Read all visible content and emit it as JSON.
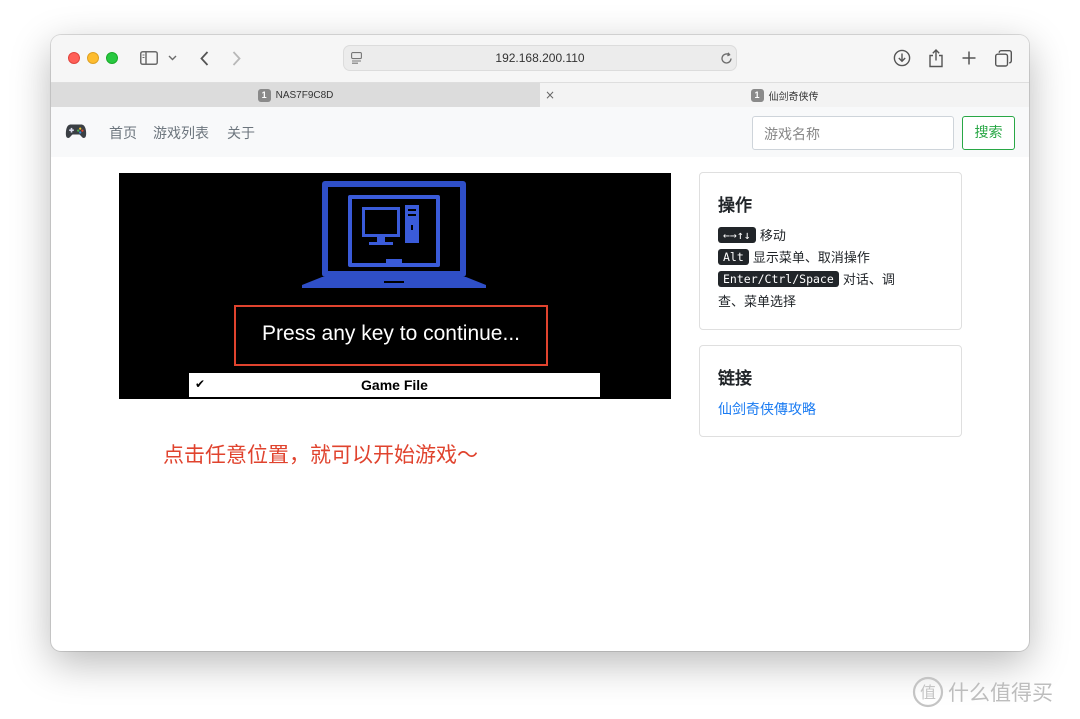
{
  "browser": {
    "url": "192.168.200.110",
    "tabs": [
      {
        "badge": "1",
        "label": "NAS7F9C8D"
      },
      {
        "badge": "1",
        "label": "仙剑奇侠传"
      }
    ],
    "tab_close_glyph": "×"
  },
  "navbar": {
    "brand_icon": "gamepad-icon",
    "links": [
      "首页",
      "游戏列表",
      "关于"
    ],
    "search_placeholder": "游戏名称",
    "search_button": "搜索"
  },
  "game": {
    "press_text": "Press any key to continue...",
    "file_check": "✔",
    "file_label": "Game File"
  },
  "hint": "点击任意位置，就可以开始游戏～",
  "sidebar": {
    "ops_title": "操作",
    "ops": [
      {
        "key": "←→↑↓",
        "desc": "移动"
      },
      {
        "key": "Alt",
        "desc": "显示菜单、取消操作"
      },
      {
        "key": "Enter/Ctrl/Space",
        "desc": "对话、调"
      }
    ],
    "ops_cont": "查、菜单选择",
    "links_title": "链接",
    "link": "仙剑奇侠傳攻略"
  },
  "watermark": "什么值得买",
  "colors": {
    "accent_green": "#28a745",
    "hint_red": "#e0432e",
    "link_blue": "#1a7bf2",
    "monitor_blue": "#3a5bd9"
  }
}
